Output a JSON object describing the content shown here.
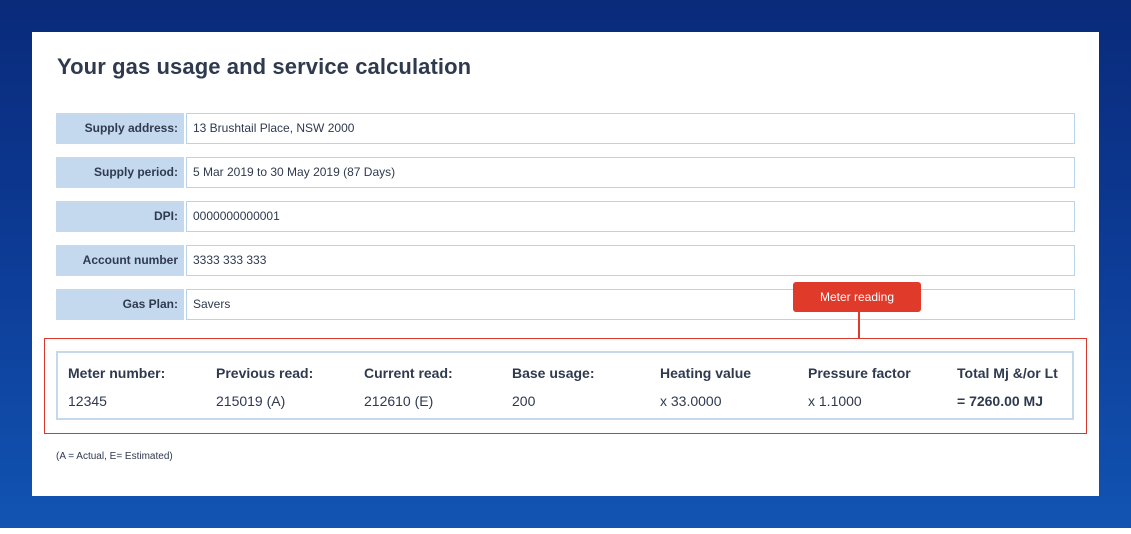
{
  "title": "Your gas usage and service calculation",
  "details": [
    {
      "label": "Supply address:",
      "value": "13 Brushtail Place, NSW 2000"
    },
    {
      "label": "Supply period:",
      "value": "5 Mar 2019 to 30 May 2019  (87 Days)"
    },
    {
      "label": "DPI:",
      "value": "0000000000001"
    },
    {
      "label": "Account number",
      "value": "3333 333 333"
    },
    {
      "label": "Gas Plan:",
      "value": "Savers"
    }
  ],
  "callout": {
    "label": "Meter reading"
  },
  "meter": {
    "columns": [
      {
        "header": "Meter number:",
        "value": "12345"
      },
      {
        "header": "Previous read:",
        "value": "215019 (A)"
      },
      {
        "header": "Current read:",
        "value": "212610 (E)"
      },
      {
        "header": "Base usage:",
        "value": "200"
      },
      {
        "header": "Heating value",
        "value": "x 33.0000"
      },
      {
        "header": "Pressure factor",
        "value": "x 1.1000"
      },
      {
        "header": "Total Mj &/or Lt",
        "value": "= 7260.00 MJ"
      }
    ]
  },
  "footnote": "(A = Actual, E= Estimated)",
  "colors": {
    "background": "#0c3a94",
    "label_fill": "#c5d9ee",
    "accent_red": "#e03a2b",
    "text": "#2f3a4f"
  }
}
